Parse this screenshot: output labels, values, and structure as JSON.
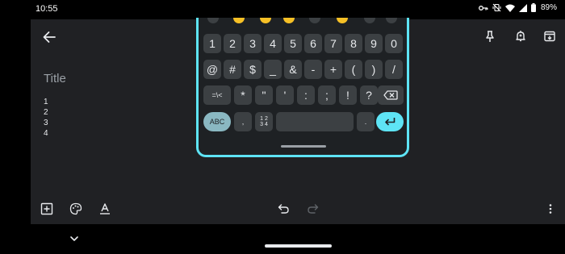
{
  "status_bar": {
    "time": "10:55",
    "battery": "89%",
    "icons": [
      "key-icon",
      "vibrate-off-icon",
      "wifi-icon",
      "signal-icon",
      "battery-icon"
    ]
  },
  "toolbar": {
    "back_icon": "arrow-back-icon",
    "actions": [
      "pin-icon",
      "reminder-icon",
      "archive-icon"
    ]
  },
  "note": {
    "title_placeholder": "Title",
    "lines": [
      "1",
      "2",
      "3",
      "4"
    ]
  },
  "keyboard": {
    "emoji_row": [
      "emoji-icon",
      "emoji-icon",
      "emoji-icon",
      "emoji-icon",
      "emoji-icon",
      "emoji-icon",
      "emoji-icon",
      "emoji-icon",
      "emoji-icon"
    ],
    "row1": [
      "1",
      "2",
      "3",
      "4",
      "5",
      "6",
      "7",
      "8",
      "9",
      "0"
    ],
    "row2": [
      "@",
      "#",
      "$",
      "_",
      "&",
      "-",
      "+",
      "(",
      ")",
      "/"
    ],
    "row3": [
      "=\\<",
      "*",
      "\"",
      "'",
      ":",
      ";",
      "!",
      "?"
    ],
    "row4": {
      "abc": "ABC",
      "comma": ",",
      "numpad_top": "1 2",
      "numpad_bottom": "3 4",
      "period": "."
    },
    "accent_color": "#5ee4f5"
  },
  "bottom_toolbar": {
    "left": [
      "add-box-icon",
      "palette-icon",
      "text-format-icon"
    ],
    "center": [
      "undo-icon",
      "redo-icon"
    ],
    "right": [
      "more-vert-icon"
    ]
  },
  "nav": {
    "icons": [
      "chevron-down-icon",
      "home-indicator"
    ]
  }
}
